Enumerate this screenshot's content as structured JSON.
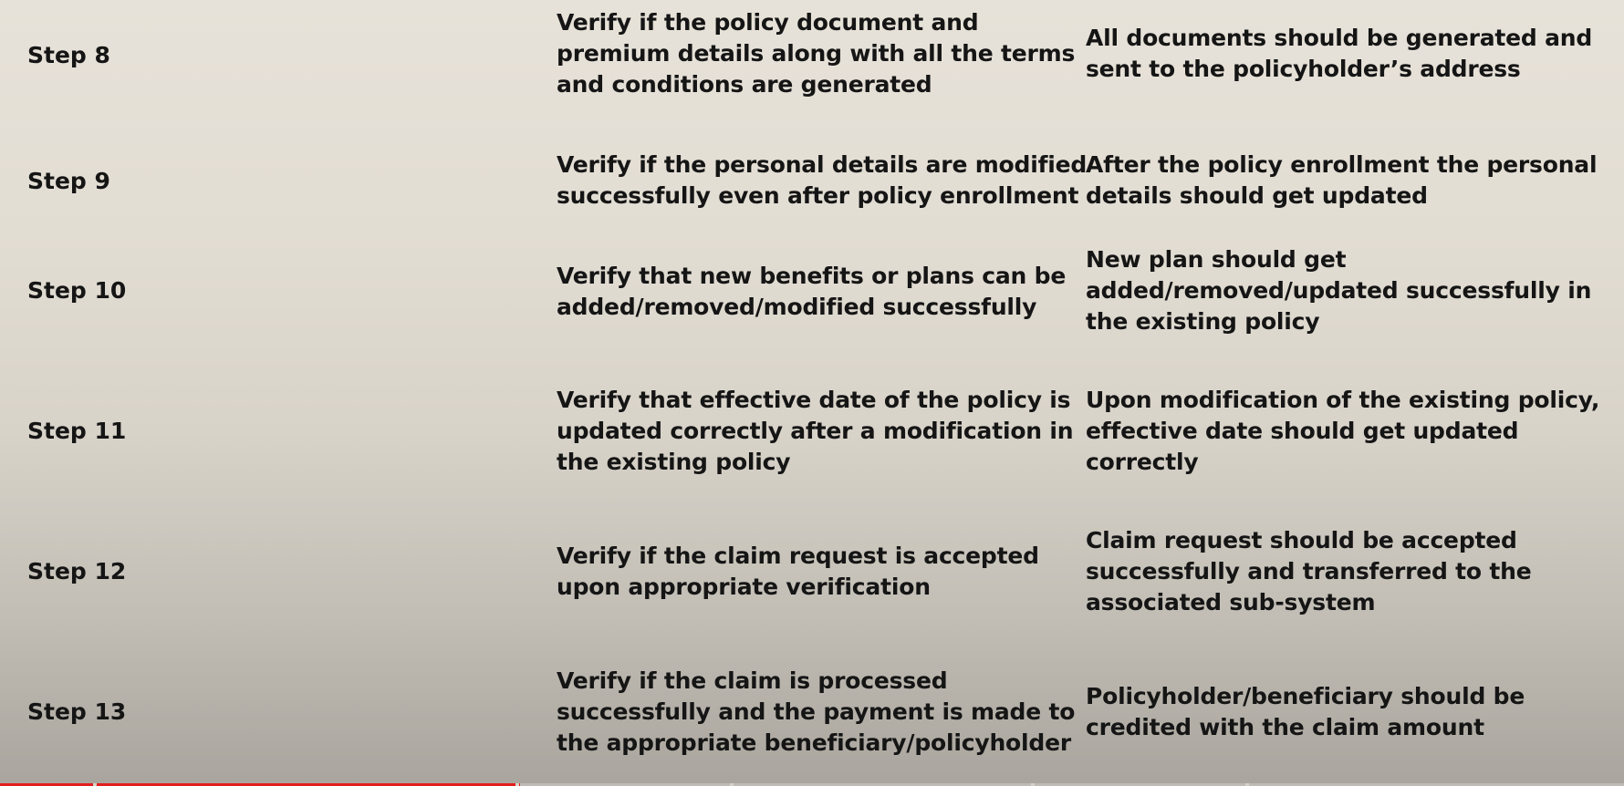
{
  "rows": [
    {
      "step": "Step 8",
      "description": [
        "Verify if the policy document and",
        "premium details along with all the terms",
        "and conditions are generated"
      ],
      "expected": [
        "All documents should be generated and",
        "sent to the policyholder’s address"
      ]
    },
    {
      "step": "Step 9",
      "description": [
        "Verify if the personal details are modified",
        "successfully even after policy enrollment"
      ],
      "expected": [
        "After the policy enrollment the personal",
        "details should get updated"
      ]
    },
    {
      "step": "Step 10",
      "description": [
        "Verify that new benefits or plans can be",
        "added/removed/modified successfully"
      ],
      "expected": [
        "New plan should get",
        "added/removed/updated successfully in",
        "the existing policy"
      ]
    },
    {
      "step": "Step 11",
      "description": [
        "Verify that effective date of the policy is",
        "updated correctly after a modification in",
        "the existing policy"
      ],
      "expected": [
        "Upon modification of the existing policy,",
        "effective date should get updated",
        "correctly"
      ]
    },
    {
      "step": "Step 12",
      "description": [
        "Verify if the claim request is accepted",
        "upon appropriate verification"
      ],
      "expected": [
        "Claim request should be accepted",
        "successfully and transferred to the",
        "associated sub-system"
      ]
    },
    {
      "step": "Step 13",
      "description": [
        "Verify if the claim is processed",
        "successfully and the payment is made to",
        "the appropriate beneficiary/policyholder"
      ],
      "expected": [
        "Policyholder/beneficiary should be",
        "credited with the claim amount"
      ]
    }
  ],
  "video_progress": {
    "fraction": 0.32,
    "color": "#e21d1d"
  }
}
